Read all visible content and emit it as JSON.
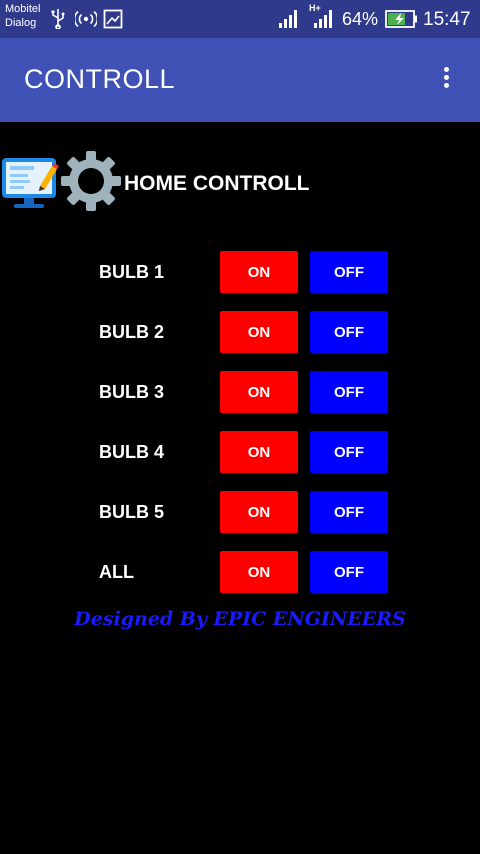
{
  "status_bar": {
    "carrier_1": "Mobitel",
    "carrier_2": "Dialog",
    "network_type": "H+",
    "battery": "64%",
    "time": "15:47"
  },
  "app_bar": {
    "title": "CONTROLL"
  },
  "header": {
    "title": "HOME CONTROLL"
  },
  "controls": [
    {
      "label": "BULB 1",
      "on": "ON",
      "off": "OFF"
    },
    {
      "label": "BULB 2",
      "on": "ON",
      "off": "OFF"
    },
    {
      "label": "BULB 3",
      "on": "ON",
      "off": "OFF"
    },
    {
      "label": "BULB 4",
      "on": "ON",
      "off": "OFF"
    },
    {
      "label": "BULB 5",
      "on": "ON",
      "off": "OFF"
    },
    {
      "label": "ALL",
      "on": "ON",
      "off": "OFF"
    }
  ],
  "footer": {
    "text": "Designed By EPIC ENGINEERS"
  },
  "colors": {
    "status_bar": "#2f3a8c",
    "app_bar": "#3f51b5",
    "on_button": "#ff0000",
    "off_button": "#0000ff",
    "footer_text": "#1a1aff",
    "background": "#000000"
  },
  "icons": [
    "usb-icon",
    "hotspot-icon",
    "screenshot-icon",
    "signal-icon",
    "battery-charging-icon",
    "overflow-menu-icon",
    "app-logo-icon",
    "gear-icon"
  ]
}
